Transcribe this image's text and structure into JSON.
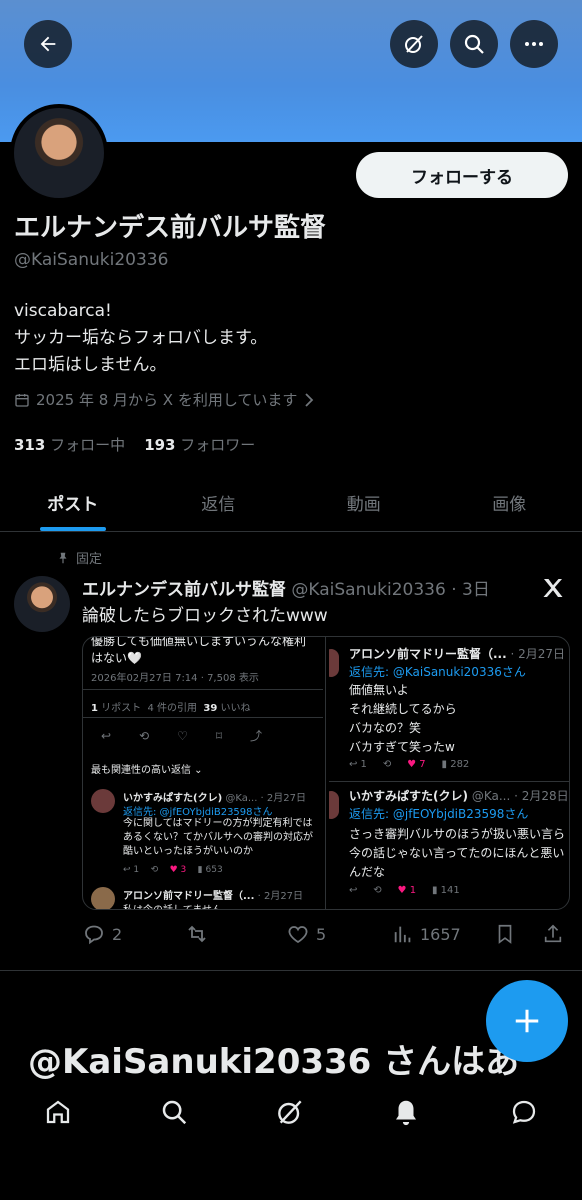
{
  "profile": {
    "name": "エルナンデス前バルサ監督",
    "handle": "@KaiSanuki20336",
    "bio": "viscabarca!\nサッカー垢ならフォロバします。\nエロ垢はしません。",
    "joined": "2025 年 8 月から X を利用しています",
    "following_count": "313",
    "following_label": "フォロー中",
    "followers_count": "193",
    "followers_label": "フォロワー",
    "follow_button": "フォローする"
  },
  "tabs": [
    "ポスト",
    "返信",
    "動画",
    "画像"
  ],
  "pinned_label": "固定",
  "post": {
    "author": "エルナンデス前バルサ監督",
    "handle_time": "@KaiSanuki20336 · 3日",
    "text": "論破したらブロックされたwww",
    "actions": {
      "replies": "2",
      "retweets": "",
      "likes": "5",
      "views": "1657"
    }
  },
  "media": {
    "left": {
      "top_text": "優勝しても価値無いしますいうんな権利はない🤍",
      "date_views": "2026年02月27日 7:14 · 7,508 表示",
      "reposts": "1",
      "reposts_label": "リポスト",
      "quotes": "4 件の引用",
      "likes": "39",
      "likes_label": "いいね",
      "sort": "最も関連性の高い返信 ⌄",
      "reply1_name": "いかすみぱすた(クレ)",
      "reply1_meta": "@Ka... · 2月27日",
      "reply1_to": "返信先: @jfEOYbjdiB23598さん",
      "reply1_text": "今に関してはマドリーの方が判定有利ではあるくない？てかバルサへの審判の対応が酷いといったほうがいいのか",
      "reply1_likes": "3",
      "reply1_views": "653",
      "reply2_name": "アロンソ前マドリー監督（...",
      "reply2_meta": "· 2月27日",
      "reply2_text": "私は今の話してません"
    },
    "right": {
      "r1_name": "アロンソ前マドリー監督（...",
      "r1_meta": "· 2月27日",
      "r1_to": "返信先: @KaiSanuki20336さん",
      "r1_text": "価値無いよ\nそれ継続してるから\nバカなの？笑\nバカすぎて笑ったw",
      "r1_likes": "7",
      "r1_views": "282",
      "r2_name": "いかすみぱすた(クレ)",
      "r2_meta": "@Ka... · 2月28日",
      "r2_to": "返信先: @jfEOYbjdiB23598さん",
      "r2_text": "さっき審判バルサのほうが扱い悪い言ら今の話じゃない言ってたのにほんと悪いんだな",
      "r2_likes": "1",
      "r2_views": "141"
    }
  },
  "footer_name": "@KaiSanuki20336 さんはあ",
  "icons": [
    "back-arrow-icon",
    "grok-icon",
    "search-icon",
    "more-icon",
    "calendar-icon",
    "chevron-right-icon",
    "pin-icon",
    "x-logo-icon",
    "reply-icon",
    "retweet-icon",
    "like-icon",
    "views-icon",
    "bookmark-icon",
    "share-icon",
    "plus-icon",
    "home-icon",
    "notifications-icon",
    "messages-icon"
  ],
  "colors": {
    "accent": "#1d9bf0",
    "banner": "#4a8ee0",
    "like_pink": "#f91880",
    "muted": "#71767b"
  }
}
